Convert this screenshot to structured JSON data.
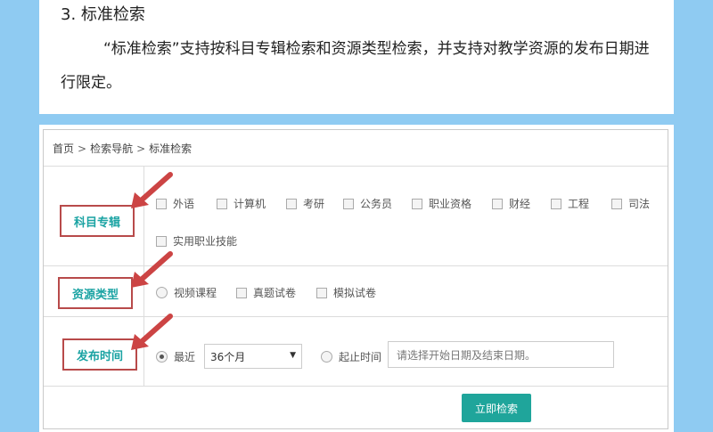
{
  "doc": {
    "heading": "3. 标准检索",
    "paragraph": "“标准检索”支持按科目专辑检索和资源类型检索，并支持对教学资源的发布日期进行限定。"
  },
  "breadcrumb": [
    "首页",
    "检索导航",
    "标准检索"
  ],
  "breadcrumb_sep": ">",
  "filters": {
    "subject": {
      "label": "科目专辑",
      "options": [
        "外语",
        "计算机",
        "考研",
        "公务员",
        "职业资格",
        "财经",
        "工程",
        "司法",
        "实用职业技能"
      ]
    },
    "resource_type": {
      "label": "资源类型",
      "options": [
        "视频课程",
        "真题试卷",
        "模拟试卷"
      ]
    },
    "publish_time": {
      "label": "发布时间",
      "recent_label": "最近",
      "recent_value": "36个月",
      "range_label": "起止时间",
      "range_placeholder": "请选择开始日期及结束日期。"
    }
  },
  "search_button": "立即检索",
  "colors": {
    "background": "#8fcbf2",
    "accent_teal": "#1fa59b",
    "label_text": "#1aa3a3",
    "annotation_red": "#b84a4a"
  }
}
